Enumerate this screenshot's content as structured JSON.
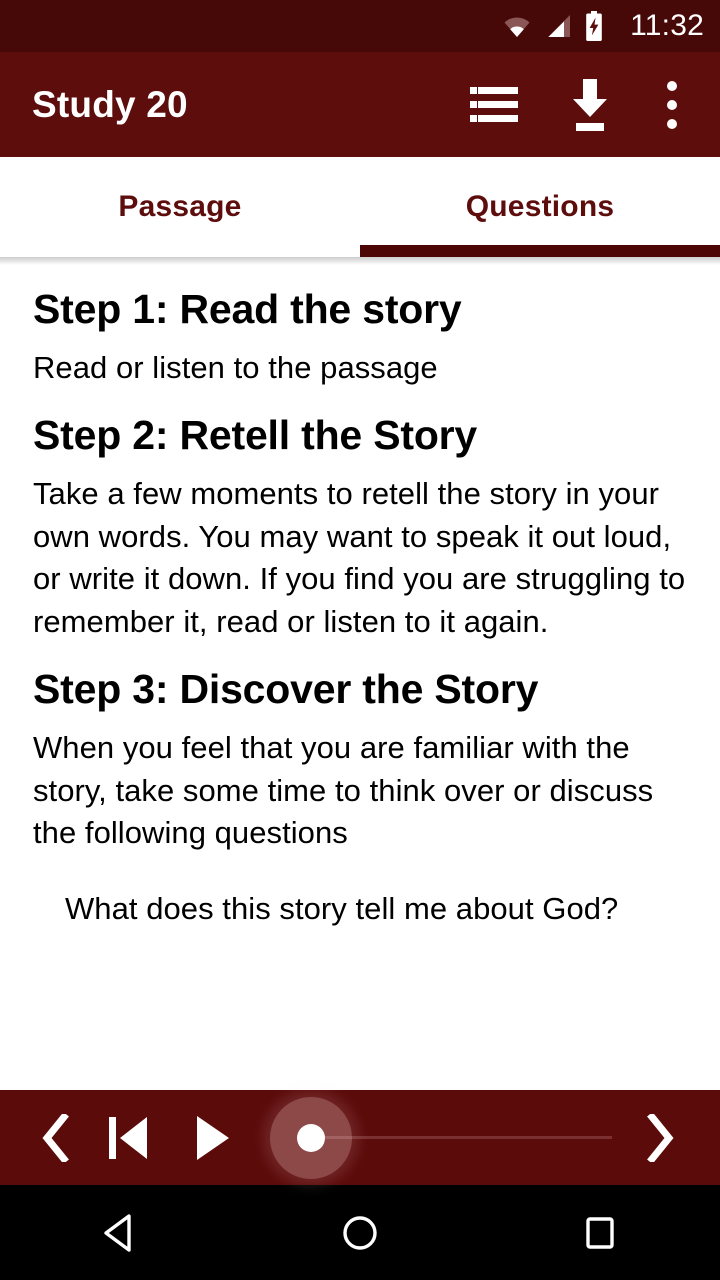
{
  "status_bar": {
    "clock": "11:32",
    "icons": [
      "wifi-icon",
      "signal-icon",
      "battery-charging-icon"
    ],
    "background": "#470808"
  },
  "app_bar": {
    "title": "Study 20",
    "background": "#5e0d0d",
    "actions": [
      {
        "name": "list-icon",
        "label": "List"
      },
      {
        "name": "download-icon",
        "label": "Download"
      },
      {
        "name": "overflow-menu-icon",
        "label": "More options"
      }
    ]
  },
  "tabs": {
    "items": [
      {
        "label": "Passage",
        "active": false
      },
      {
        "label": "Questions",
        "active": true
      }
    ],
    "active_index": 1,
    "text_color": "#5e0d0d",
    "indicator_color": "#4d0606"
  },
  "content": {
    "sections": [
      {
        "heading": "Step 1: Read the story",
        "body": "Read or listen to the passage"
      },
      {
        "heading": "Step 2: Retell the Story",
        "body": "Take a few moments to retell the story in your own words. You may want to speak it out loud, or write it down. If you find you are struggling to remember it, read or listen to it again."
      },
      {
        "heading": "Step 3: Discover the Story",
        "body": "When you feel that you are familiar with the story, take some time to think over or discuss the following questions"
      }
    ],
    "questions": [
      "What does this story tell me about God?"
    ]
  },
  "player": {
    "background": "#5c0b0b",
    "controls": [
      {
        "name": "previous-chevron-icon",
        "label": "Previous"
      },
      {
        "name": "skip-previous-icon",
        "label": "Skip to start"
      },
      {
        "name": "play-icon",
        "label": "Play"
      },
      {
        "name": "next-chevron-icon",
        "label": "Next"
      }
    ],
    "seek": {
      "progress_percent": 0
    }
  },
  "nav_bar": {
    "background": "#000000",
    "buttons": [
      {
        "name": "nav-back-icon",
        "label": "Back"
      },
      {
        "name": "nav-home-icon",
        "label": "Home"
      },
      {
        "name": "nav-recents-icon",
        "label": "Recents"
      }
    ]
  }
}
